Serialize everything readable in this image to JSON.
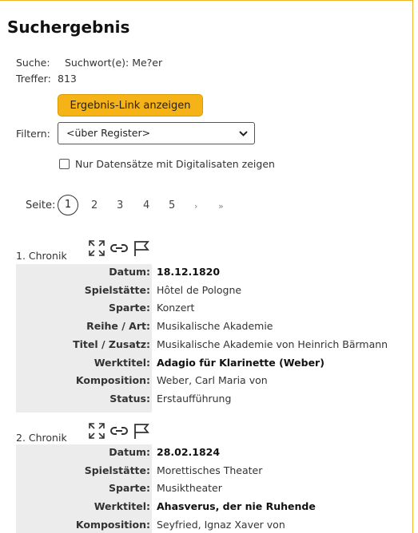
{
  "title": "Suchergebnis",
  "search": {
    "label": "Suche:",
    "value": "Suchwort(e): Me?er"
  },
  "hits": {
    "label": "Treffer:",
    "value": "813"
  },
  "result_link_button": "Ergebnis-Link anzeigen",
  "filter": {
    "label": "Filtern:",
    "selected": "<über Register>"
  },
  "digital_checkbox": {
    "label": "Nur Datensätze mit Digitalisaten zeigen",
    "checked": false
  },
  "pagination": {
    "label": "Seite:",
    "current": "1",
    "pages": [
      "2",
      "3",
      "4",
      "5"
    ],
    "next": "›",
    "last": "»"
  },
  "records": [
    {
      "label": "1. Chronik",
      "fields": [
        {
          "name": "Datum:",
          "value": "18.12.1820",
          "bold": true
        },
        {
          "name": "Spielstätte:",
          "value": "Hôtel de Pologne",
          "bold": false
        },
        {
          "name": "Sparte:",
          "value": "Konzert",
          "bold": false
        },
        {
          "name": "Reihe / Art:",
          "value": "Musikalische Akademie",
          "bold": false
        },
        {
          "name": "Titel / Zusatz:",
          "value": "Musikalische Akademie von Heinrich Bärmann",
          "bold": false
        },
        {
          "name": "Werktitel:",
          "value": "Adagio für Klarinette (Weber)",
          "bold": true
        },
        {
          "name": "Komposition:",
          "value": "Weber, Carl Maria von",
          "bold": false
        },
        {
          "name": "Status:",
          "value": "Erstaufführung",
          "bold": false
        }
      ]
    },
    {
      "label": "2. Chronik",
      "fields": [
        {
          "name": "Datum:",
          "value": "28.02.1824",
          "bold": true
        },
        {
          "name": "Spielstätte:",
          "value": "Morettisches Theater",
          "bold": false
        },
        {
          "name": "Sparte:",
          "value": "Musiktheater",
          "bold": false
        },
        {
          "name": "Werktitel:",
          "value": "Ahasverus, der nie Ruhende",
          "bold": true
        },
        {
          "name": "Komposition:",
          "value": "Seyfried, Ignaz Xaver von",
          "bold": false
        }
      ]
    }
  ],
  "icons": [
    "expand-icon",
    "link-icon",
    "flag-icon"
  ],
  "colors": {
    "accent": "#f6b318",
    "border": "#f0b429",
    "record_bg": "#ececec"
  }
}
